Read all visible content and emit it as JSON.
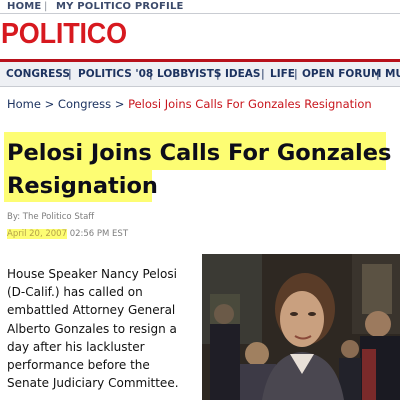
{
  "header": {
    "home_link": "HOME",
    "separator": "|",
    "profile_link": "MY POLITICO PROFILE",
    "logo_text": "POLITICO",
    "brand_color": "#d7191f"
  },
  "nav": {
    "items": [
      "CONGRESS",
      "POLITICS '08",
      "LOBBYISTS",
      "IDEAS",
      "LIFE",
      "OPEN FORUM",
      "MU"
    ],
    "separator": "|"
  },
  "breadcrumb": {
    "home": "Home",
    "arrow": ">",
    "section": "Congress",
    "current": "Pelosi Joins Calls For Gonzales Resignation"
  },
  "article": {
    "headline_line1": "Pelosi Joins Calls For Gonzales",
    "headline_line2": "Resignation",
    "byline": "By: The Politico Staff",
    "date": "April 20, 2007",
    "time": "02:56 PM EST",
    "body_lines": [
      "House Speaker Nancy Pelosi",
      "(D-Calif.) has called on",
      "embattled Attorney General",
      "Alberto Gonzales to resign a",
      "day after his lackluster",
      "performance before the",
      "Senate Judiciary Committee."
    ],
    "photo_icon": "news-photo"
  }
}
